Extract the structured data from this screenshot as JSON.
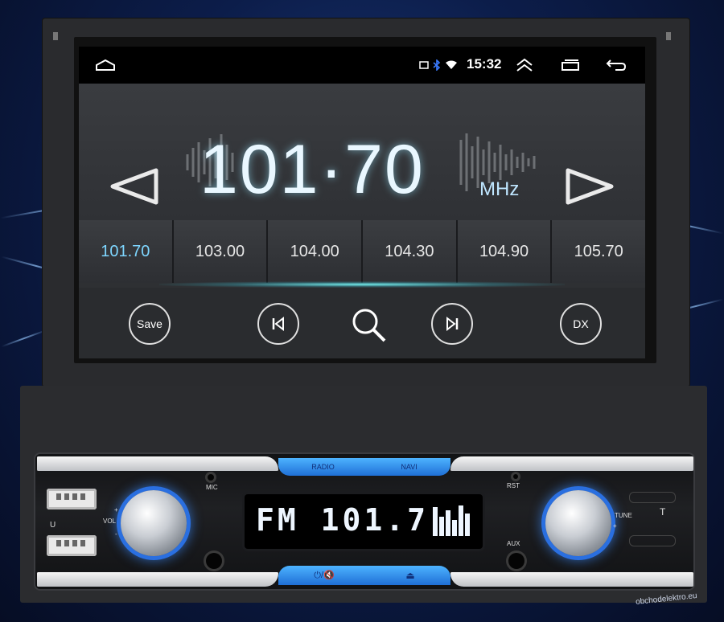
{
  "statusbar": {
    "time": "15:32",
    "icons": [
      "home-icon",
      "cast-icon",
      "bluetooth-icon",
      "wifi-icon",
      "chevrons-up-icon",
      "recent-apps-icon",
      "back-icon"
    ]
  },
  "radio": {
    "frequency": "101·70",
    "unit": "MHz",
    "presets": [
      "101.70",
      "103.00",
      "104.00",
      "104.30",
      "104.90",
      "105.70"
    ],
    "active_preset_index": 0
  },
  "controls": {
    "save_label": "Save",
    "dx_label": "DX",
    "buttons": [
      "save",
      "previous",
      "search",
      "next",
      "dx"
    ]
  },
  "faceplate": {
    "tab_top_left": "RADIO",
    "tab_top_right": "NAVI",
    "mic_label": "MIC",
    "rst_label": "RST",
    "aux_label": "AUX",
    "vol_label": "VOL",
    "tune_label": "TUNE",
    "t_label": "T",
    "u_label": "U",
    "plus": "+",
    "minus": "-",
    "lcd_text": "FM 101.7",
    "power_mute_label": "⏻/🔇",
    "eject_label": "⏏"
  },
  "watermark": "obchodelektro.eu",
  "colors": {
    "accent_glow": "#7ed6ff",
    "knob_ring": "#2a6fe0",
    "tab_blue": "#4db3ff"
  }
}
